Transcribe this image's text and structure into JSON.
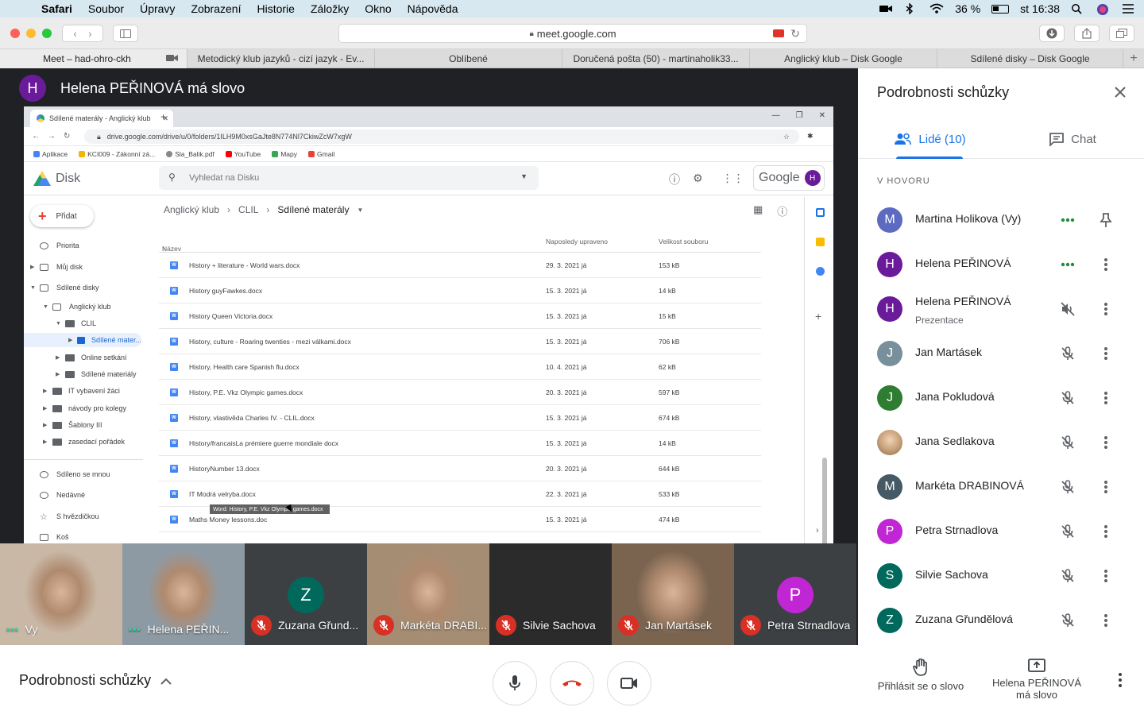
{
  "menubar": {
    "app": "Safari",
    "items": [
      "Soubor",
      "Úpravy",
      "Zobrazení",
      "Historie",
      "Záložky",
      "Okno",
      "Nápověda"
    ],
    "battery": "36 %",
    "clock": "st 16:38"
  },
  "browser": {
    "url": "meet.google.com",
    "tabs": [
      "Meet – had-ohro-ckh",
      "Metodický klub jazyků - cizí jazyk - Ev...",
      "Oblíbené",
      "Doručená pošta (50) - martinaholik33...",
      "Anglický klub – Disk Google",
      "Sdílené disky – Disk Google"
    ]
  },
  "presenter": {
    "initial": "H",
    "text": "Helena PEŘINOVÁ má slovo"
  },
  "shared_screen": {
    "chrome_tab": "Sdílené materály - Anglický klub",
    "address": "drive.google.com/drive/u/0/folders/1ILH9M0xsGaJte8N774Nl7CkiwZcW7xgW",
    "bookmarks": [
      "Aplikace",
      "KCI009 - Zákonní zá...",
      "Sla_Balik.pdf",
      "YouTube",
      "Mapy",
      "Gmail"
    ],
    "drive_name": "Disk",
    "search_placeholder": "Vyhledat na Disku",
    "google_label": "Google",
    "avatar_initial": "H",
    "new_button": "Přidat",
    "sidebar": [
      "Priorita",
      "Můj disk",
      "Sdílené disky",
      "Anglický klub",
      "CLIL",
      "Sdílené mater...",
      "Online setkání",
      "Sdílené materiály",
      "IT vybavení žáci",
      "návody pro kolegy",
      "Šablony III",
      "zasedací pořádek",
      "Sdíleno se mnou",
      "Nedávné",
      "S hvězdičkou",
      "Koš"
    ],
    "breadcrumb": [
      "Anglický klub",
      "CLIL",
      "Sdílené materály"
    ],
    "columns": {
      "name": "Název",
      "modified": "Naposledy upraveno",
      "size": "Velikost souboru"
    },
    "files": [
      {
        "name": "History + literature - World wars.docx",
        "date": "29. 3. 2021 já",
        "size": "153 kB"
      },
      {
        "name": "History guyFawkes.docx",
        "date": "15. 3. 2021 já",
        "size": "14 kB"
      },
      {
        "name": "History Queen Victoria.docx",
        "date": "15. 3. 2021 já",
        "size": "15 kB"
      },
      {
        "name": "History, culture - Roaring twenties - mezi válkami.docx",
        "date": "15. 3. 2021 já",
        "size": "706 kB"
      },
      {
        "name": "History, Health care Spanish flu.docx",
        "date": "10. 4. 2021 já",
        "size": "62 kB"
      },
      {
        "name": "History, P.E. Vkz Olympic games.docx",
        "date": "20. 3. 2021 já",
        "size": "597 kB"
      },
      {
        "name": "History, vlastivěda Charles IV. - CLIL.docx",
        "date": "15. 3. 2021 já",
        "size": "674 kB"
      },
      {
        "name": "History/francaisLa prémiere guerre mondiale docx",
        "date": "15. 3. 2021 já",
        "size": "14 kB"
      },
      {
        "name": "HistoryNumber 13.docx",
        "date": "20. 3. 2021 já",
        "size": "644 kB"
      },
      {
        "name": "IT Modrá velryba.docx",
        "date": "22. 3. 2021 já",
        "size": "533 kB"
      },
      {
        "name": "Maths Money lessons.doc",
        "date": "15. 3. 2021 já",
        "size": "474 kB"
      }
    ],
    "tooltip": "Word: History, P.E. Vkz Olympic games.docx"
  },
  "strip": [
    {
      "label": "Vy",
      "type": "video",
      "speaking": true,
      "bg": "#c9b8a6"
    },
    {
      "label": "Helena PEŘIN...",
      "type": "video",
      "speaking": true,
      "bg": "#8e9aa3"
    },
    {
      "label": "Zuzana Gřund...",
      "type": "avatar",
      "initial": "Z",
      "color": "#00695c",
      "muted": true
    },
    {
      "label": "Markéta DRABI...",
      "type": "video",
      "muted": true,
      "bg": "#a58d73"
    },
    {
      "label": "Silvie Sachova",
      "type": "dark",
      "muted": true
    },
    {
      "label": "Jan Martásek",
      "type": "video",
      "muted": true,
      "bg": "#7a6450"
    },
    {
      "label": "Petra Strnadlova",
      "type": "avatar",
      "initial": "P",
      "color": "#c026d3",
      "muted": true
    }
  ],
  "panel": {
    "title": "Podrobnosti schůzky",
    "tab_people": "Lidé (10)",
    "tab_chat": "Chat",
    "section": "V HOVORU",
    "people": [
      {
        "name": "Martina Holikova (Vy)",
        "initial": "M",
        "color": "#5c6bc0",
        "state": "talking",
        "action": "pin"
      },
      {
        "name": "Helena PEŘINOVÁ",
        "initial": "H",
        "color": "#6a1b9a",
        "state": "talking",
        "action": "more"
      },
      {
        "name": "Helena PEŘINOVÁ",
        "sub": "Prezentace",
        "initial": "H",
        "color": "#6a1b9a",
        "state": "sound-off",
        "action": "more"
      },
      {
        "name": "Jan Martásek",
        "initial": "J",
        "color": "#78909c",
        "state": "muted",
        "action": "more"
      },
      {
        "name": "Jana Pokludová",
        "initial": "J",
        "color": "#2e7d32",
        "state": "muted",
        "action": "more"
      },
      {
        "name": "Jana Sedlakova",
        "initial": "",
        "color": "#c8a27a",
        "state": "muted",
        "action": "more"
      },
      {
        "name": "Markéta DRABINOVÁ",
        "initial": "M",
        "color": "#455a64",
        "state": "muted",
        "action": "more"
      },
      {
        "name": "Petra Strnadlova",
        "initial": "P",
        "color": "#c026d3",
        "state": "muted",
        "action": "more"
      },
      {
        "name": "Silvie Sachova",
        "initial": "S",
        "color": "#00695c",
        "state": "muted",
        "action": "more"
      },
      {
        "name": "Zuzana Gřundělová",
        "initial": "Z",
        "color": "#00695c",
        "state": "muted",
        "action": "more"
      }
    ]
  },
  "bottombar": {
    "details": "Podrobnosti schůzky",
    "raise_hand": "Přihlásit se o slovo",
    "presenting": "Helena PEŘINOVÁ má slovo"
  }
}
